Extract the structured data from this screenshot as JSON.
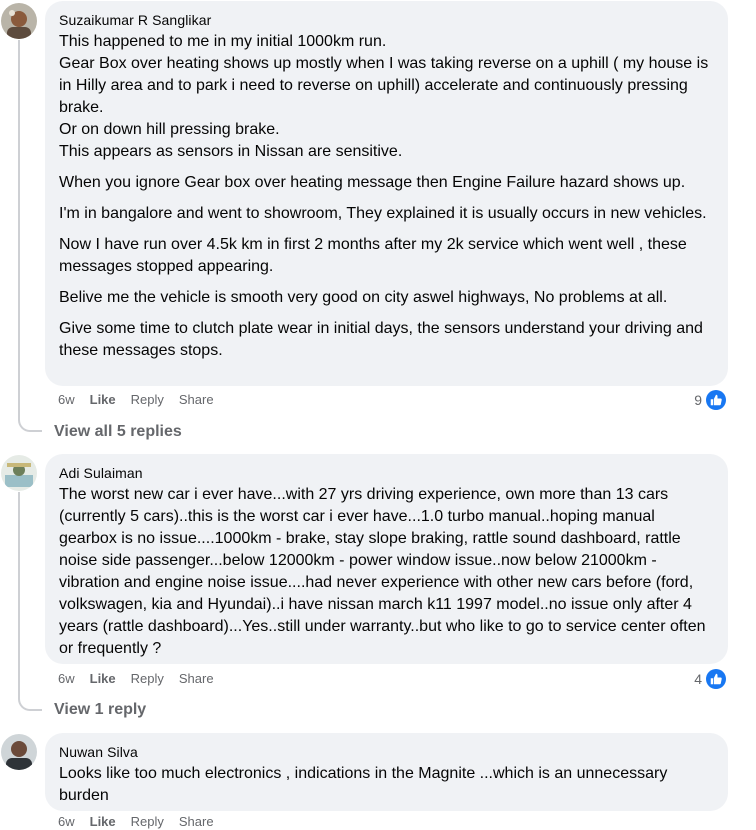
{
  "comments": [
    {
      "author": "Suzaikumar R Sanglikar",
      "paragraphs": [
        "This happened to me in my initial 1000km run.\nGear Box over heating shows up mostly when I was taking reverse on a uphill ( my house is in Hilly area and to park i need to reverse on uphill) accelerate and continuously pressing brake.\nOr on down hill pressing brake.\nThis appears as sensors in Nissan are sensitive.",
        "When you ignore Gear box over heating message then Engine Failure hazard shows up.",
        "I'm in bangalore and went to showroom, They explained it is usually occurs in new vehicles.",
        "Now I have run over 4.5k km in first 2 months after my 2k service which went well , these messages stopped appearing.",
        "Belive me the vehicle is smooth very good on city aswel highways, No problems at all.",
        "Give some time to clutch plate wear in initial days, the sensors understand your driving and these messages stops."
      ],
      "time": "6w",
      "like": "Like",
      "reply": "Reply",
      "share": "Share",
      "reaction_count": "9",
      "view_replies": "View all 5 replies"
    },
    {
      "author": "Adi Sulaiman",
      "paragraphs": [
        "The worst new car i ever have...with 27 yrs driving experience, own more than 13 cars (currently 5 cars)..this is the worst car i ever have...1.0 turbo manual..hoping manual gearbox is no issue....1000km - brake, stay slope braking, rattle sound dashboard, rattle noise side passenger...below 12000km - power window issue..now below 21000km - vibration and engine noise issue....had never experience with other new cars before (ford, volkswagen, kia and Hyundai)..i have nissan march k11 1997 model..no issue only after 4 years (rattle dashboard)...Yes..still under warranty..but who like to go to service center often or frequently ?"
      ],
      "time": "6w",
      "like": "Like",
      "reply": "Reply",
      "share": "Share",
      "reaction_count": "4",
      "view_replies": "View 1 reply"
    },
    {
      "author": "Nuwan Silva",
      "paragraphs": [
        "Looks like too much electronics , indications in the Magnite ...which is an unnecessary burden"
      ],
      "time": "6w",
      "like": "Like",
      "reply": "Reply",
      "share": "Share"
    }
  ],
  "colors": {
    "bubble": "#f0f2f5",
    "meta": "#65676b",
    "like_blue": "#1877f2"
  }
}
